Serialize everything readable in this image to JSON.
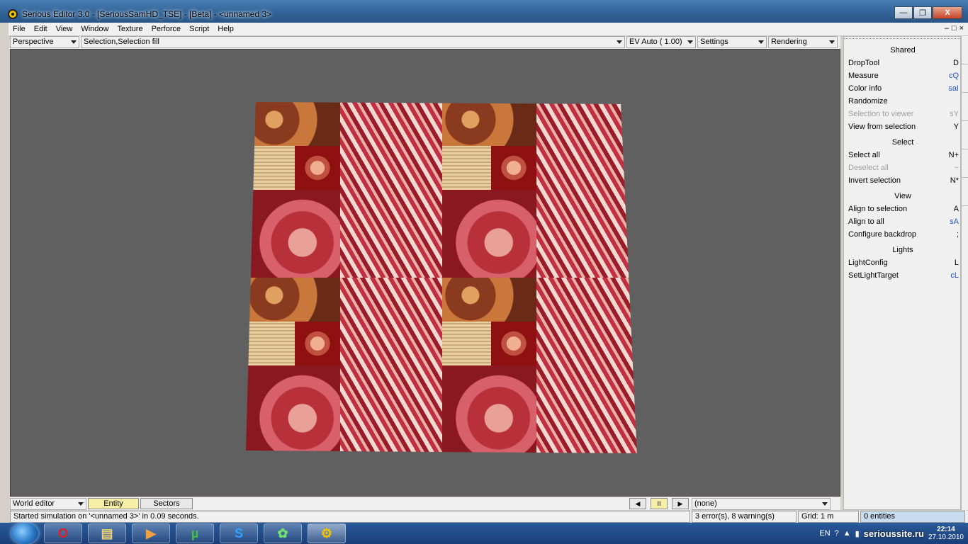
{
  "window": {
    "title": "Serious Editor 3.0 - [SeriousSamHD_TSE] - [Beta] - <unnamed 3>",
    "minimize": "—",
    "restore": "❐",
    "close": "X"
  },
  "menu": {
    "items": [
      "File",
      "Edit",
      "View",
      "Window",
      "Texture",
      "Perforce",
      "Script",
      "Help"
    ],
    "mdi_min": "–",
    "mdi_restore": "□",
    "mdi_close": "×"
  },
  "toolbar": {
    "view_mode": "Perspective",
    "selection_mode": "Selection,Selection fill",
    "exposure": "EV Auto ( 1.00)",
    "settings": "Settings",
    "rendering": "Rendering"
  },
  "bottom": {
    "editor_mode": "World editor",
    "tab_entity": "Entity",
    "tab_sectors": "Sectors",
    "prev": "◀",
    "pause": "II",
    "next": "▶",
    "target": "(none)"
  },
  "status": {
    "message": "Started simulation on '<unnamed 3>' in 0.09 seconds.",
    "errors": "3 error(s), 8 warning(s)",
    "grid": "Grid: 1 m",
    "entities": "0 entities"
  },
  "right_panel": {
    "sections": [
      {
        "title": "Shared",
        "items": [
          {
            "label": "DropTool",
            "shortcut": "D",
            "blue": false,
            "disabled": false
          },
          {
            "label": "Measure",
            "shortcut": "cQ",
            "blue": true,
            "disabled": false
          },
          {
            "label": "Color info",
            "shortcut": "saI",
            "blue": true,
            "disabled": false
          },
          {
            "label": "Randomize",
            "shortcut": "",
            "blue": false,
            "disabled": false
          },
          {
            "label": "Selection to viewer",
            "shortcut": "sY",
            "blue": false,
            "disabled": true
          },
          {
            "label": "View from selection",
            "shortcut": "Y",
            "blue": false,
            "disabled": false
          }
        ]
      },
      {
        "title": "Select",
        "items": [
          {
            "label": "Select all",
            "shortcut": "N+",
            "blue": false,
            "disabled": false
          },
          {
            "label": "Deselect all",
            "shortcut": "~",
            "blue": false,
            "disabled": true
          },
          {
            "label": "Invert selection",
            "shortcut": "N*",
            "blue": false,
            "disabled": false
          }
        ]
      },
      {
        "title": "View",
        "items": [
          {
            "label": "Align to selection",
            "shortcut": "A",
            "blue": false,
            "disabled": false
          },
          {
            "label": "Align to all",
            "shortcut": "sA",
            "blue": true,
            "disabled": false
          },
          {
            "label": "Configure backdrop",
            "shortcut": ";",
            "blue": false,
            "disabled": false
          }
        ]
      },
      {
        "title": "Lights",
        "items": [
          {
            "label": "LightConfig",
            "shortcut": "L",
            "blue": false,
            "disabled": false
          },
          {
            "label": "SetLightTarget",
            "shortcut": "cL",
            "blue": true,
            "disabled": false
          }
        ]
      }
    ]
  },
  "taskbar": {
    "apps": [
      {
        "name": "opera",
        "glyph": "O"
      },
      {
        "name": "explorer",
        "glyph": "▤"
      },
      {
        "name": "media-player",
        "glyph": "▶"
      },
      {
        "name": "utorrent",
        "glyph": "µ"
      },
      {
        "name": "skype",
        "glyph": "S"
      },
      {
        "name": "icq",
        "glyph": "✿"
      },
      {
        "name": "serious-editor",
        "glyph": "⚙"
      }
    ],
    "lang": "EN",
    "watermark": "serioussite.ru",
    "time": "22:14",
    "date": "27.10.2010"
  },
  "colors": {
    "viewport_bg": "#606060",
    "active_tab": "#f7efa8",
    "info_cell": "#c8dcf0",
    "shortcut_blue": "#1f4fc8"
  }
}
